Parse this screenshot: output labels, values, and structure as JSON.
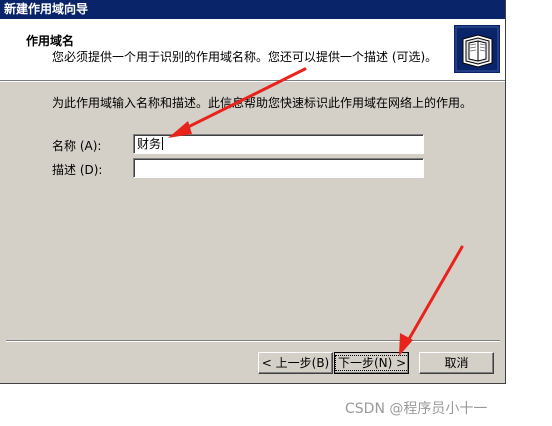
{
  "window": {
    "title": "新建作用域向导"
  },
  "header": {
    "title": "作用域名",
    "subtitle": "您必须提供一个用于识别的作用域名称。您还可以提供一个描述 (可选)。",
    "icon": "folders-icon"
  },
  "body": {
    "description": "为此作用域输入名称和描述。此信息帮助您快速标识此作用域在网络上的作用。",
    "name_label": "名称 (A):",
    "name_value": "财务",
    "desc_label": "描述 (D):",
    "desc_value": ""
  },
  "buttons": {
    "back": "< 上一步(B)",
    "next": "下一步(N) >",
    "cancel": "取消"
  },
  "watermark": "CSDN @程序员小十一",
  "colors": {
    "titlebar": "#0a246a",
    "dialog_bg": "#d4d0c8",
    "annotation_arrow": "#e8231b"
  }
}
